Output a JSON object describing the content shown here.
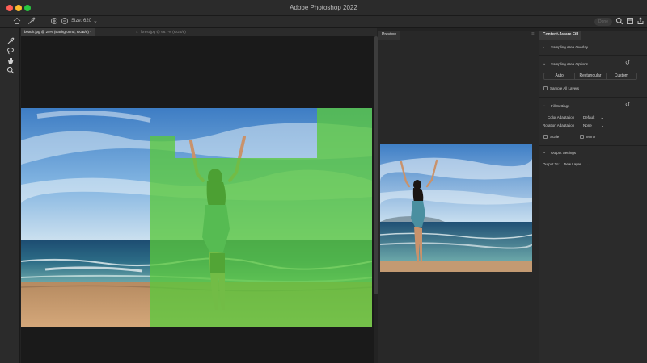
{
  "window": {
    "title": "Adobe Photoshop 2022"
  },
  "options_bar": {
    "size_label": "Size: 620",
    "done_label": "Done"
  },
  "tabs": [
    {
      "label": "beach.jpg @ 25% (Background, RGB/8) *"
    },
    {
      "label": "forest.jpg @ 66.7% (RGB/8)"
    }
  ],
  "preview": {
    "title": "Preview"
  },
  "properties": {
    "title": "Content-Aware Fill",
    "sampling_area_overlay": "Sampling Area Overlay",
    "sampling_area_options": "Sampling Area Options",
    "segments": [
      "Auto",
      "Rectangular",
      "Custom"
    ],
    "sample_all_layers": "Sample All Layers",
    "fill_settings": "Fill Settings",
    "color_adaptation_label": "Color Adaptation",
    "color_adaptation_value": "Default",
    "rotation_adaptation_label": "Rotation Adaptation",
    "rotation_adaptation_value": "None",
    "scale_label": "Scale",
    "mirror_label": "Mirror",
    "output_settings": "Output Settings",
    "output_to_label": "Output To:",
    "output_to_value": "New Layer"
  },
  "colors": {
    "overlay_green": "#5ac83c",
    "accent": "#2f7bf5"
  }
}
